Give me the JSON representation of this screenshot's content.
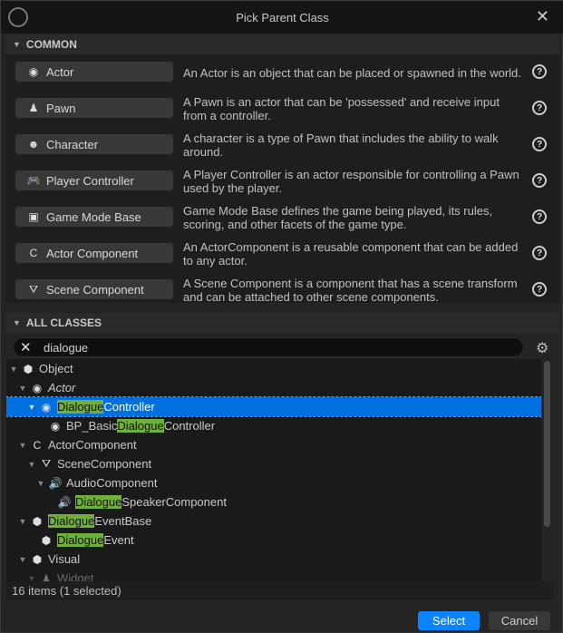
{
  "window": {
    "title": "Pick Parent Class",
    "logo": "U"
  },
  "common": {
    "header": "COMMON",
    "items": [
      {
        "label": "Actor",
        "icon": "actor-icon",
        "glyph": "◉",
        "desc": "An Actor is an object that can be placed or spawned in the world."
      },
      {
        "label": "Pawn",
        "icon": "pawn-icon",
        "glyph": "♟",
        "desc": "A Pawn is an actor that can be 'possessed' and receive input from a controller."
      },
      {
        "label": "Character",
        "icon": "character-icon",
        "glyph": "☻",
        "desc": "A character is a type of Pawn that includes the ability to walk around."
      },
      {
        "label": "Player Controller",
        "icon": "gamepad-icon",
        "glyph": "🎮",
        "desc": "A Player Controller is an actor responsible for controlling a Pawn used by the player."
      },
      {
        "label": "Game Mode Base",
        "icon": "game-mode-icon",
        "glyph": "▣",
        "desc": "Game Mode Base defines the game being played, its rules, scoring, and other facets of the game type."
      },
      {
        "label": "Actor Component",
        "icon": "component-icon",
        "glyph": "C",
        "desc": "An ActorComponent is a reusable component that can be added to any actor."
      },
      {
        "label": "Scene Component",
        "icon": "scene-component-icon",
        "glyph": "⛛",
        "desc": "A Scene Component is a component that has a scene transform and can be attached to other scene components."
      }
    ],
    "help_glyph": "?"
  },
  "all_classes": {
    "header": "ALL CLASSES",
    "search_value": "dialogue",
    "gear_glyph": "⚙",
    "clear_glyph": "✕",
    "tree": [
      {
        "depth": 0,
        "expander": true,
        "icon": "object-icon",
        "glyph": "⬢",
        "pre": "Object",
        "hl": "",
        "post": ""
      },
      {
        "depth": 1,
        "expander": true,
        "icon": "actor-icon",
        "glyph": "◉",
        "pre": "Actor",
        "hl": "",
        "post": "",
        "italic": true
      },
      {
        "depth": 2,
        "expander": true,
        "icon": "actor-icon",
        "glyph": "◉",
        "pre": "",
        "hl": "Dialogue",
        "post": "Controller",
        "selected": true
      },
      {
        "depth": 3,
        "expander": false,
        "icon": "actor-icon",
        "glyph": "◉",
        "pre": "BP_Basic",
        "hl": "Dialogue",
        "post": "Controller"
      },
      {
        "depth": 1,
        "expander": true,
        "icon": "component-icon",
        "glyph": "C",
        "pre": "ActorComponent",
        "hl": "",
        "post": ""
      },
      {
        "depth": 2,
        "expander": true,
        "icon": "scene-component-icon",
        "glyph": "⛛",
        "pre": "SceneComponent",
        "hl": "",
        "post": ""
      },
      {
        "depth": 3,
        "expander": true,
        "icon": "speaker-icon",
        "glyph": "🔊",
        "pre": "AudioComponent",
        "hl": "",
        "post": ""
      },
      {
        "depth": 4,
        "expander": false,
        "icon": "speaker-icon",
        "glyph": "🔊",
        "pre": "",
        "hl": "Dialogue",
        "post": "SpeakerComponent"
      },
      {
        "depth": 1,
        "expander": true,
        "icon": "object-icon",
        "glyph": "⬢",
        "pre": "",
        "hl": "Dialogue",
        "post": "EventBase"
      },
      {
        "depth": 2,
        "expander": false,
        "icon": "object-icon",
        "glyph": "⬢",
        "pre": "",
        "hl": "Dialogue",
        "post": "Event"
      },
      {
        "depth": 1,
        "expander": true,
        "icon": "object-icon",
        "glyph": "⬢",
        "pre": "Visual",
        "hl": "",
        "post": ""
      },
      {
        "depth": 2,
        "expander": true,
        "icon": "widget-icon",
        "glyph": "♟",
        "pre": "Widget",
        "hl": "",
        "post": "",
        "faded": true
      }
    ],
    "status": "16 items (1 selected)"
  },
  "footer": {
    "select_label": "Select",
    "cancel_label": "Cancel"
  },
  "colors": {
    "accent": "#0a84ff",
    "highlight": "#6fb03a",
    "selection": "#0070e0"
  }
}
